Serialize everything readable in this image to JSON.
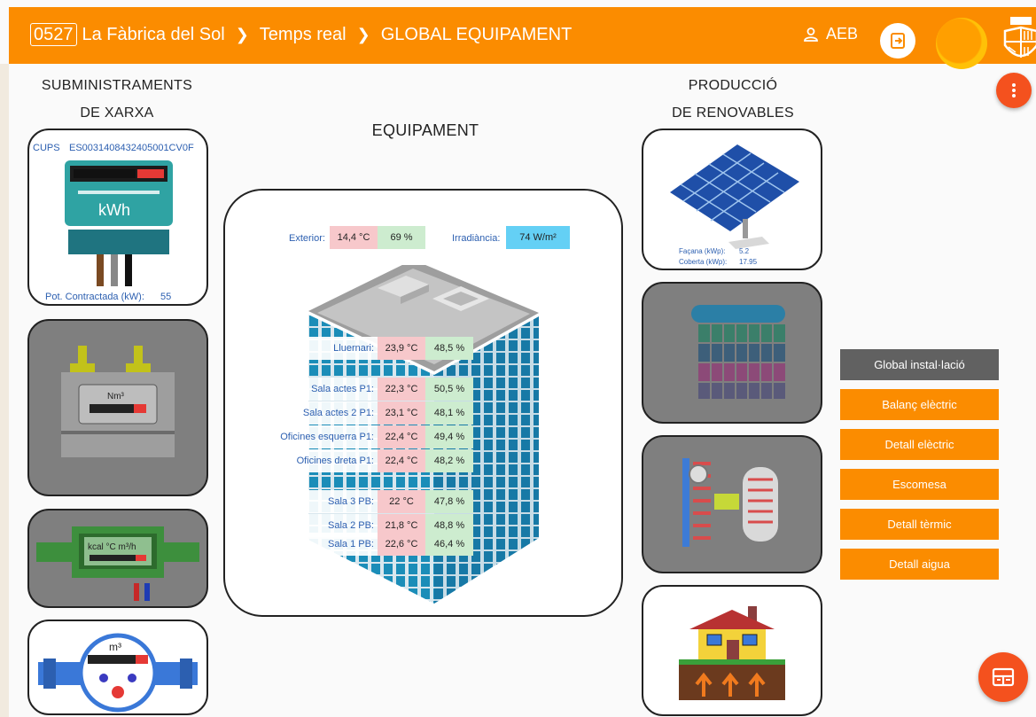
{
  "header": {
    "code": "0527",
    "site": "La Fàbrica del Sol",
    "crumb1": "Temps real",
    "crumb2": "GLOBAL EQUIPAMENT",
    "user": "AEB"
  },
  "left": {
    "title1": "SUBMINISTRAMENTS",
    "title2": "DE XARXA",
    "electric": {
      "cups_label": "CUPS",
      "cups": "ES0031408432405001CV0F",
      "unit": "kWh",
      "pot_label": "Pot. Contractada (kW):",
      "pot_value": "55"
    },
    "gas_unit": "Nm³",
    "thermal_unit": "kcal °C m³/h",
    "water_unit": "m³"
  },
  "right": {
    "title1": "PRODUCCIÓ",
    "title2": "DE RENOVABLES",
    "solar": {
      "facana_label": "Façana (kWp):",
      "facana_value": "5.2",
      "coberta_label": "Coberta (kWp):",
      "coberta_value": "17.95"
    }
  },
  "main": {
    "title": "EQUIPAMENT",
    "exterior_label": "Exterior:",
    "exterior_temp": "14,4 °C",
    "exterior_hum": "69 %",
    "irradiance_label": "Irradiància:",
    "irradiance_value": "74 W/m²",
    "rooms": [
      {
        "name": "Lluernari:",
        "temp": "23,9 °C",
        "hum": "48,5 %"
      },
      {
        "name": "Sala actes P1:",
        "temp": "22,3 °C",
        "hum": "50,5 %"
      },
      {
        "name": "Sala actes 2 P1:",
        "temp": "23,1 °C",
        "hum": "48,1 %"
      },
      {
        "name": "Oficines esquerra P1:",
        "temp": "22,4 °C",
        "hum": "49,4 %"
      },
      {
        "name": "Oficines dreta P1:",
        "temp": "22,4 °C",
        "hum": "48,2 %"
      },
      {
        "name": "Sala 3 PB:",
        "temp": "22 °C",
        "hum": "47,8 %"
      },
      {
        "name": "Sala 2 PB:",
        "temp": "21,8 °C",
        "hum": "48,8 %"
      },
      {
        "name": "Sala 1 PB:",
        "temp": "22,6 °C",
        "hum": "46,4 %"
      }
    ]
  },
  "menu": [
    {
      "label": "Global instal·lació"
    },
    {
      "label": "Balanç elèctric"
    },
    {
      "label": "Detall elèctric"
    },
    {
      "label": "Escomesa"
    },
    {
      "label": "Detall tèrmic"
    },
    {
      "label": "Detall aigua"
    }
  ],
  "colors": {
    "primary": "#fb8c00",
    "active_menu": "#616161",
    "fab": "#f4511e",
    "temp_cell": "#f7c8cb",
    "hum_cell": "#cdeccf",
    "irradiance_cell": "#64d0f5"
  },
  "icons": {
    "user": "user-icon",
    "logout": "logout-icon",
    "more": "more-vert-icon",
    "dashboard": "dashboard-icon"
  }
}
